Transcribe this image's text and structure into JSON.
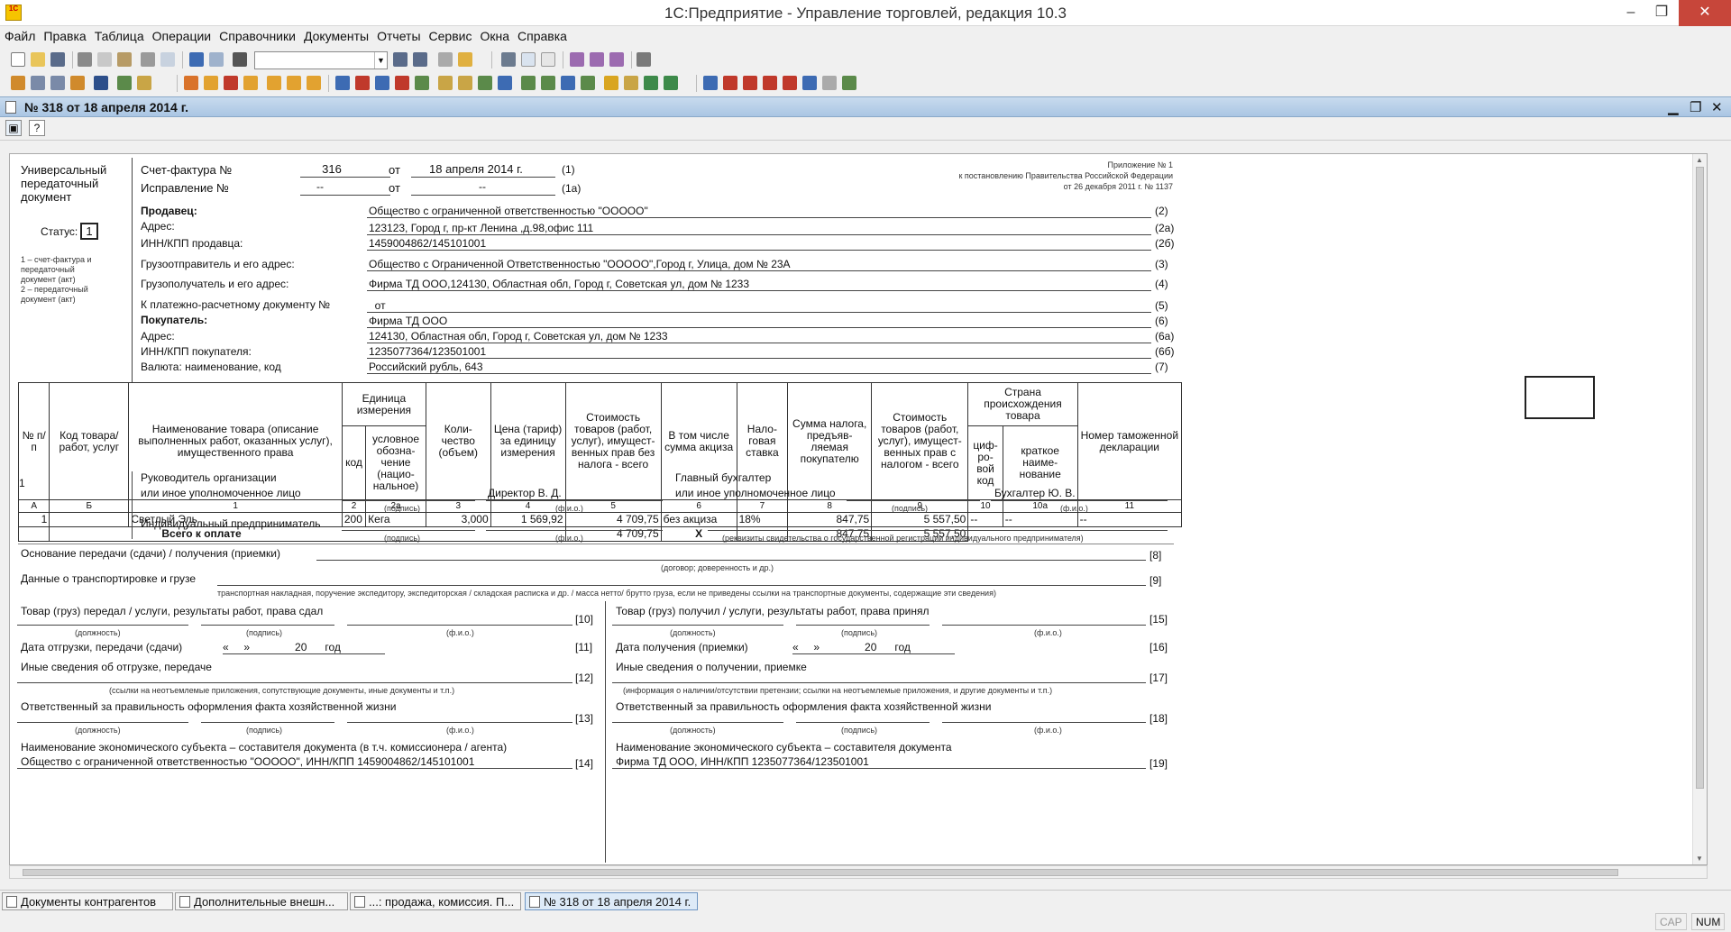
{
  "window": {
    "title": "1С:Предприятие - Управление торговлей, редакция 10.3",
    "logo_text": "1С",
    "minimize": "–",
    "maximize": "❐",
    "close": "✕"
  },
  "menu": [
    "Файл",
    "Правка",
    "Таблица",
    "Операции",
    "Справочники",
    "Документы",
    "Отчеты",
    "Сервис",
    "Окна",
    "Справка"
  ],
  "toolbar": {
    "search_value": "",
    "combo_arrow": "▼"
  },
  "document_window": {
    "title": "№ 318 от 18 апреля 2014 г.",
    "minimize": "▁",
    "restore": "❐",
    "close": "✕",
    "help_label": "?"
  },
  "form": {
    "left_header": [
      "Универсальный",
      "передаточный",
      "документ"
    ],
    "status_label": "Статус:",
    "status_value": "1",
    "status_note": [
      "1 – счет-фактура и",
      "передаточный",
      "документ (акт)",
      "2 – передаточный",
      "документ (акт)"
    ],
    "invoice_label": "Счет-фактура №",
    "invoice_number": "316",
    "from_label": "от",
    "invoice_date": "18 апреля 2014 г.",
    "invoice_code": "(1)",
    "correction_label": "Исправление №",
    "correction_number": "--",
    "correction_date": "--",
    "correction_code": "(1а)",
    "appendix": [
      "Приложение № 1",
      "к постановлению Правительства Российской Федерации",
      "от 26 декабря 2011 г. № 1137"
    ],
    "fields": [
      {
        "label": "Продавец:",
        "value": "Общество с ограниченной ответственностью \"ООООО\"",
        "code": "(2)",
        "bold": true
      },
      {
        "label": "Адрес:",
        "value": "123123, Город г, пр-кт Ленина ,д.98,офис 111",
        "code": "(2а)"
      },
      {
        "label": "ИНН/КПП продавца:",
        "value": "1459004862/145101001",
        "code": "(2б)"
      },
      {
        "label": "Грузоотправитель и его адрес:",
        "value": "Общество с Ограниченной Ответственностью \"ООООО\",Город г, Улица, дом № 23А",
        "code": "(3)"
      },
      {
        "label": "Грузополучатель и его адрес:",
        "value": "Фирма ТД ООО,124130, Областная обл, Город г, Советская ул, дом № 1233",
        "code": "(4)"
      },
      {
        "label": "К платежно-расчетному документу №",
        "value": "  от",
        "code": "(5)"
      },
      {
        "label": "Покупатель:",
        "value": "Фирма ТД ООО",
        "code": "(6)",
        "bold": true
      },
      {
        "label": "Адрес:",
        "value": "124130, Областная обл, Город г, Советская ул, дом № 1233",
        "code": "(6а)"
      },
      {
        "label": "ИНН/КПП покупателя:",
        "value": "1235077364/123501001",
        "code": "(6б)"
      },
      {
        "label": "Валюта: наименование, код",
        "value": "Российский рубль, 643",
        "code": "(7)"
      }
    ]
  },
  "table": {
    "headers": {
      "num": "№ п/п",
      "code": "Код товара/ работ, услуг",
      "name": "Наименование товара (описание выполненных работ, оказанных услуг), имущественного права",
      "unit": "Единица измерения",
      "unit_code": "код",
      "unit_name": "условное обозна-чение (нацио-нальное)",
      "qty": "Коли-чество (объем)",
      "price": "Цена (тариф) за единицу измерения",
      "cost": "Стоимость товаров (работ, услуг), имущест-венных прав без налога - всего",
      "excise": "В том числе сумма акциза",
      "rate": "Нало-говая ставка",
      "tax": "Сумма налога, предъяв-ляемая покупателю",
      "total": "Стоимость товаров (работ, услуг), имущест-венных прав с налогом - всего",
      "country": "Страна происхождения товара",
      "country_code": "циф-ро-вой код",
      "country_name": "краткое наиме-нование",
      "customs": "Номер таможенной декларации"
    },
    "column_numbers": [
      "А",
      "Б",
      "1",
      "2",
      "2а",
      "3",
      "4",
      "5",
      "6",
      "7",
      "8",
      "9",
      "10",
      "10а",
      "11"
    ],
    "rows": [
      {
        "num": "1",
        "code": "",
        "name": "Светлый Эль",
        "unit_code": "200",
        "unit_name": "Кега",
        "qty": "3,000",
        "price": "1 569,92",
        "cost": "4 709,75",
        "excise": "без акциза",
        "rate": "18%",
        "tax": "847,75",
        "total": "5 557,50",
        "country_code": "--",
        "country_name": "--",
        "customs": "--"
      }
    ],
    "total_label": "Всего к оплате",
    "total_cost": "4 709,75",
    "total_excise": "X",
    "total_tax": "847,75",
    "total_sum": "5 557,50"
  },
  "signatures": {
    "sheets": "1",
    "head_label_1": "Руководитель организации",
    "head_label_2": "или иное уполномоченное лицо",
    "head_name": "Директор В. Д.",
    "accountant_label_1": "Главный бухгалтер",
    "accountant_label_2": "или иное уполномоченное лицо",
    "accountant_name": "Бухгалтер Ю. В.",
    "entrepreneur_label": "Индивидуальный предприниматель",
    "sign_hint": "(подпись)",
    "fio_hint": "(ф.и.о.)",
    "registration_hint": "(реквизиты свидетельства о государственной  регистрации индивидуального предпринимателя)"
  },
  "transfer": {
    "basis_label": "Основание передачи (сдачи) / получения (приемки)",
    "basis_code": "[8]",
    "basis_hint": "(договор; доверенность и др.)",
    "transport_label": "Данные о транспортировке и грузе",
    "transport_code": "[9]",
    "transport_hint": "транспортная накладная, поручение экспедитору, экспедиторская / складская расписка и др. / масса нетто/ брутто груза, если не приведены ссылки на транспортные документы, содержащие эти сведения)",
    "left": {
      "handed_label": "Товар (груз) передал / услуги, результаты работ, права сдал",
      "handed_code": "[10]",
      "date_label": "Дата отгрузки, передачи (сдачи)",
      "date_value": "«     »               20      год",
      "date_code": "[11]",
      "other_label": "Иные сведения об отгрузке, передаче",
      "other_code": "[12]",
      "other_hint": "(ссылки на неотъемлемые приложения, сопутствующие документы, иные документы и т.п.)",
      "resp_label": "Ответственный за правильность оформления факта хозяйственной жизни",
      "resp_code": "[13]",
      "entity_label": "Наименование экономического субъекта – составителя документа (в т.ч. комиссионера / агента)",
      "entity_value": "Общество с ограниченной ответственностью \"ООООО\", ИНН/КПП 1459004862/145101001",
      "entity_code": "[14]"
    },
    "right": {
      "received_label": "Товар (груз) получил / услуги, результаты работ, права принял",
      "received_code": "[15]",
      "date_label": "Дата получения (приемки)",
      "date_value": "«     »               20      год",
      "date_code": "[16]",
      "other_label": "Иные сведения о получении, приемке",
      "other_code": "[17]",
      "other_hint": "(информация о наличии/отсутствии претензии; ссылки на неотъемлемые приложения, и другие  документы и т.п.)",
      "resp_label": "Ответственный за правильность оформления факта хозяйственной жизни",
      "resp_code": "[18]",
      "entity_label": "Наименование экономического субъекта – составителя документа",
      "entity_value": "Фирма ТД ООО, ИНН/КПП 1235077364/123501001",
      "entity_code": "[19]"
    },
    "position_hint": "(должность)",
    "sign_hint": "(подпись)",
    "fio_hint": "(ф.и.о.)"
  },
  "taskbar": [
    {
      "label": "Документы контрагентов",
      "active": false
    },
    {
      "label": "Дополнительные внешн...",
      "active": false
    },
    {
      "label": "...: продажа, комиссия. П...",
      "active": false
    },
    {
      "label": "№ 318 от 18 апреля 2014 г.",
      "active": true
    }
  ],
  "status": {
    "cap": "CAP",
    "num": "NUM"
  }
}
